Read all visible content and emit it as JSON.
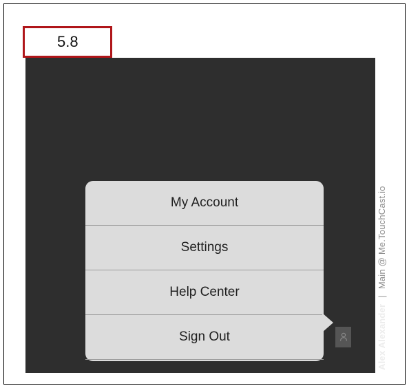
{
  "step_label": "5.8",
  "header": {
    "user_name": "Alex Alexander",
    "separator": "|",
    "workspace": "Main @ Me.TouchCast.io"
  },
  "menu": {
    "items": [
      {
        "label": "My Account"
      },
      {
        "label": "Settings"
      },
      {
        "label": "Help Center"
      },
      {
        "label": "Sign Out"
      }
    ]
  },
  "icons": {
    "avatar": "user-icon"
  },
  "colors": {
    "step_border": "#b0161a",
    "panel_background": "#2e2e2e",
    "menu_background": "#dcdcdc"
  }
}
